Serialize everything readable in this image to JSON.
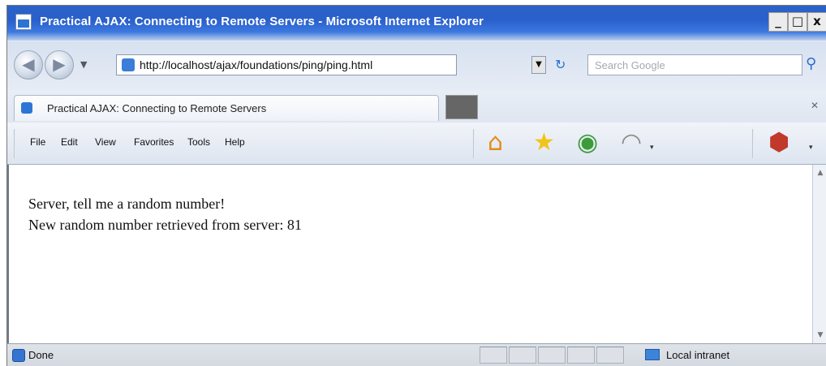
{
  "window": {
    "title": "Practical AJAX: Connecting to Remote Servers - Microsoft Internet Explorer",
    "buttons": {
      "minimize": "_",
      "maximize": "□",
      "close": "x"
    }
  },
  "address_bar": {
    "url": "http://localhost/ajax/foundations/ping/ping.html",
    "search_placeholder": "Search Google"
  },
  "tabs": [
    {
      "label": "Practical AJAX: Connecting to Remote Servers"
    }
  ],
  "menu": {
    "items": [
      "File",
      "Edit",
      "View",
      "Favorites",
      "Tools",
      "Help"
    ]
  },
  "toolbar": {
    "icons": [
      "home-icon",
      "favorites-star-icon",
      "feeds-icon",
      "rss-icon",
      "research-icon"
    ]
  },
  "content": {
    "line1": "Server, tell me a random number!",
    "line2": "New random number retrieved from server: 81"
  },
  "status_bar": {
    "status": "Done",
    "zone": "Local intranet"
  }
}
